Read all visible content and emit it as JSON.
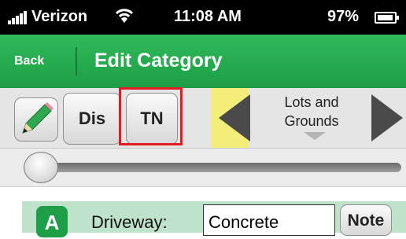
{
  "status_bar": {
    "carrier": "Verizon",
    "time": "11:08 AM",
    "battery": "97%"
  },
  "nav_bar": {
    "back_label": "Back",
    "title": "Edit Category"
  },
  "toolbar": {
    "dis_label": "Dis",
    "tn_label": "TN",
    "category_label": "Lots and\nGrounds"
  },
  "slider": {
    "value_fraction": 0.0
  },
  "list": {
    "item": {
      "badge": "A",
      "label": "Driveway:",
      "value": "Concrete",
      "note_label": "Note"
    }
  },
  "colors": {
    "accent_green": "#2fba5a",
    "highlight_red": "#e41b23",
    "row_green": "#bfe2cb"
  },
  "icons": [
    "signal-bars-icon",
    "wifi-icon",
    "battery-icon",
    "pencil-icon",
    "left-arrow-icon",
    "right-arrow-icon",
    "chevron-down-icon"
  ]
}
